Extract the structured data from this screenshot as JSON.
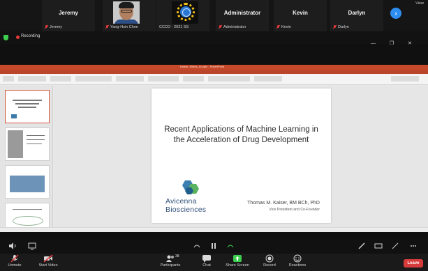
{
  "participants": [
    {
      "name": "Jeremy",
      "tag": "Jeremy",
      "tile": "name"
    },
    {
      "name": "",
      "tag": "Yang-Hsin Chen",
      "tile": "photo"
    },
    {
      "name": "",
      "tag": "CCCO - 2021 SS",
      "tile": "logo"
    },
    {
      "name": "Administrator",
      "tag": "Administrator",
      "tile": "name"
    },
    {
      "name": "Kevin",
      "tag": "Kevin",
      "tile": "name"
    },
    {
      "name": "Darlyn",
      "tag": "Darlyn",
      "tile": "name"
    }
  ],
  "strip": {
    "view_label": "View",
    "next_icon": "chevron-right-icon"
  },
  "recording": {
    "label": "Recording",
    "color": "#e53b3b"
  },
  "window_controls": "— ❐ ✕",
  "powerpoint": {
    "window_title": "Kaiser_Slides_AI.pptx - PowerPoint",
    "accent": "#c6492a"
  },
  "slide": {
    "title": "Recent Applications of Machine Learning in the Acceleration of Drug Development",
    "logo_line1": "Avicenna",
    "logo_line2": "Biosciences",
    "author": "Thomas M. Kaiser, BM BCh, PhD",
    "role": "Vice President and Co-Founder"
  },
  "toolbar": {
    "items": [
      {
        "label": "Unmute",
        "icon": "muted-mic-icon"
      },
      {
        "label": "Start Video",
        "icon": "video-off-icon"
      },
      {
        "label": "Participants",
        "icon": "participants-icon",
        "badge": "38"
      },
      {
        "label": "Chat",
        "icon": "chat-icon"
      },
      {
        "label": "Share Screen",
        "icon": "share-screen-icon"
      },
      {
        "label": "Record",
        "icon": "record-icon"
      },
      {
        "label": "Reactions",
        "icon": "reactions-icon"
      }
    ],
    "leave": "Leave",
    "share_color": "#3ccf4f",
    "leave_color": "#d63a3a"
  }
}
